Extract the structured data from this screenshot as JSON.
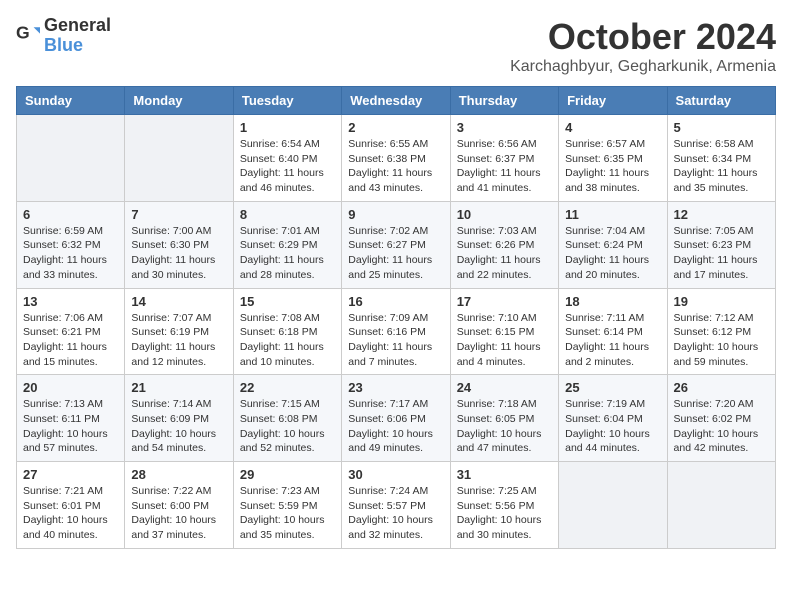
{
  "logo": {
    "general": "General",
    "blue": "Blue"
  },
  "header": {
    "month": "October 2024",
    "location": "Karchaghbyur, Gegharkunik, Armenia"
  },
  "weekdays": [
    "Sunday",
    "Monday",
    "Tuesday",
    "Wednesday",
    "Thursday",
    "Friday",
    "Saturday"
  ],
  "weeks": [
    [
      {
        "day": "",
        "info": ""
      },
      {
        "day": "",
        "info": ""
      },
      {
        "day": "1",
        "info": "Sunrise: 6:54 AM\nSunset: 6:40 PM\nDaylight: 11 hours and 46 minutes."
      },
      {
        "day": "2",
        "info": "Sunrise: 6:55 AM\nSunset: 6:38 PM\nDaylight: 11 hours and 43 minutes."
      },
      {
        "day": "3",
        "info": "Sunrise: 6:56 AM\nSunset: 6:37 PM\nDaylight: 11 hours and 41 minutes."
      },
      {
        "day": "4",
        "info": "Sunrise: 6:57 AM\nSunset: 6:35 PM\nDaylight: 11 hours and 38 minutes."
      },
      {
        "day": "5",
        "info": "Sunrise: 6:58 AM\nSunset: 6:34 PM\nDaylight: 11 hours and 35 minutes."
      }
    ],
    [
      {
        "day": "6",
        "info": "Sunrise: 6:59 AM\nSunset: 6:32 PM\nDaylight: 11 hours and 33 minutes."
      },
      {
        "day": "7",
        "info": "Sunrise: 7:00 AM\nSunset: 6:30 PM\nDaylight: 11 hours and 30 minutes."
      },
      {
        "day": "8",
        "info": "Sunrise: 7:01 AM\nSunset: 6:29 PM\nDaylight: 11 hours and 28 minutes."
      },
      {
        "day": "9",
        "info": "Sunrise: 7:02 AM\nSunset: 6:27 PM\nDaylight: 11 hours and 25 minutes."
      },
      {
        "day": "10",
        "info": "Sunrise: 7:03 AM\nSunset: 6:26 PM\nDaylight: 11 hours and 22 minutes."
      },
      {
        "day": "11",
        "info": "Sunrise: 7:04 AM\nSunset: 6:24 PM\nDaylight: 11 hours and 20 minutes."
      },
      {
        "day": "12",
        "info": "Sunrise: 7:05 AM\nSunset: 6:23 PM\nDaylight: 11 hours and 17 minutes."
      }
    ],
    [
      {
        "day": "13",
        "info": "Sunrise: 7:06 AM\nSunset: 6:21 PM\nDaylight: 11 hours and 15 minutes."
      },
      {
        "day": "14",
        "info": "Sunrise: 7:07 AM\nSunset: 6:19 PM\nDaylight: 11 hours and 12 minutes."
      },
      {
        "day": "15",
        "info": "Sunrise: 7:08 AM\nSunset: 6:18 PM\nDaylight: 11 hours and 10 minutes."
      },
      {
        "day": "16",
        "info": "Sunrise: 7:09 AM\nSunset: 6:16 PM\nDaylight: 11 hours and 7 minutes."
      },
      {
        "day": "17",
        "info": "Sunrise: 7:10 AM\nSunset: 6:15 PM\nDaylight: 11 hours and 4 minutes."
      },
      {
        "day": "18",
        "info": "Sunrise: 7:11 AM\nSunset: 6:14 PM\nDaylight: 11 hours and 2 minutes."
      },
      {
        "day": "19",
        "info": "Sunrise: 7:12 AM\nSunset: 6:12 PM\nDaylight: 10 hours and 59 minutes."
      }
    ],
    [
      {
        "day": "20",
        "info": "Sunrise: 7:13 AM\nSunset: 6:11 PM\nDaylight: 10 hours and 57 minutes."
      },
      {
        "day": "21",
        "info": "Sunrise: 7:14 AM\nSunset: 6:09 PM\nDaylight: 10 hours and 54 minutes."
      },
      {
        "day": "22",
        "info": "Sunrise: 7:15 AM\nSunset: 6:08 PM\nDaylight: 10 hours and 52 minutes."
      },
      {
        "day": "23",
        "info": "Sunrise: 7:17 AM\nSunset: 6:06 PM\nDaylight: 10 hours and 49 minutes."
      },
      {
        "day": "24",
        "info": "Sunrise: 7:18 AM\nSunset: 6:05 PM\nDaylight: 10 hours and 47 minutes."
      },
      {
        "day": "25",
        "info": "Sunrise: 7:19 AM\nSunset: 6:04 PM\nDaylight: 10 hours and 44 minutes."
      },
      {
        "day": "26",
        "info": "Sunrise: 7:20 AM\nSunset: 6:02 PM\nDaylight: 10 hours and 42 minutes."
      }
    ],
    [
      {
        "day": "27",
        "info": "Sunrise: 7:21 AM\nSunset: 6:01 PM\nDaylight: 10 hours and 40 minutes."
      },
      {
        "day": "28",
        "info": "Sunrise: 7:22 AM\nSunset: 6:00 PM\nDaylight: 10 hours and 37 minutes."
      },
      {
        "day": "29",
        "info": "Sunrise: 7:23 AM\nSunset: 5:59 PM\nDaylight: 10 hours and 35 minutes."
      },
      {
        "day": "30",
        "info": "Sunrise: 7:24 AM\nSunset: 5:57 PM\nDaylight: 10 hours and 32 minutes."
      },
      {
        "day": "31",
        "info": "Sunrise: 7:25 AM\nSunset: 5:56 PM\nDaylight: 10 hours and 30 minutes."
      },
      {
        "day": "",
        "info": ""
      },
      {
        "day": "",
        "info": ""
      }
    ]
  ]
}
